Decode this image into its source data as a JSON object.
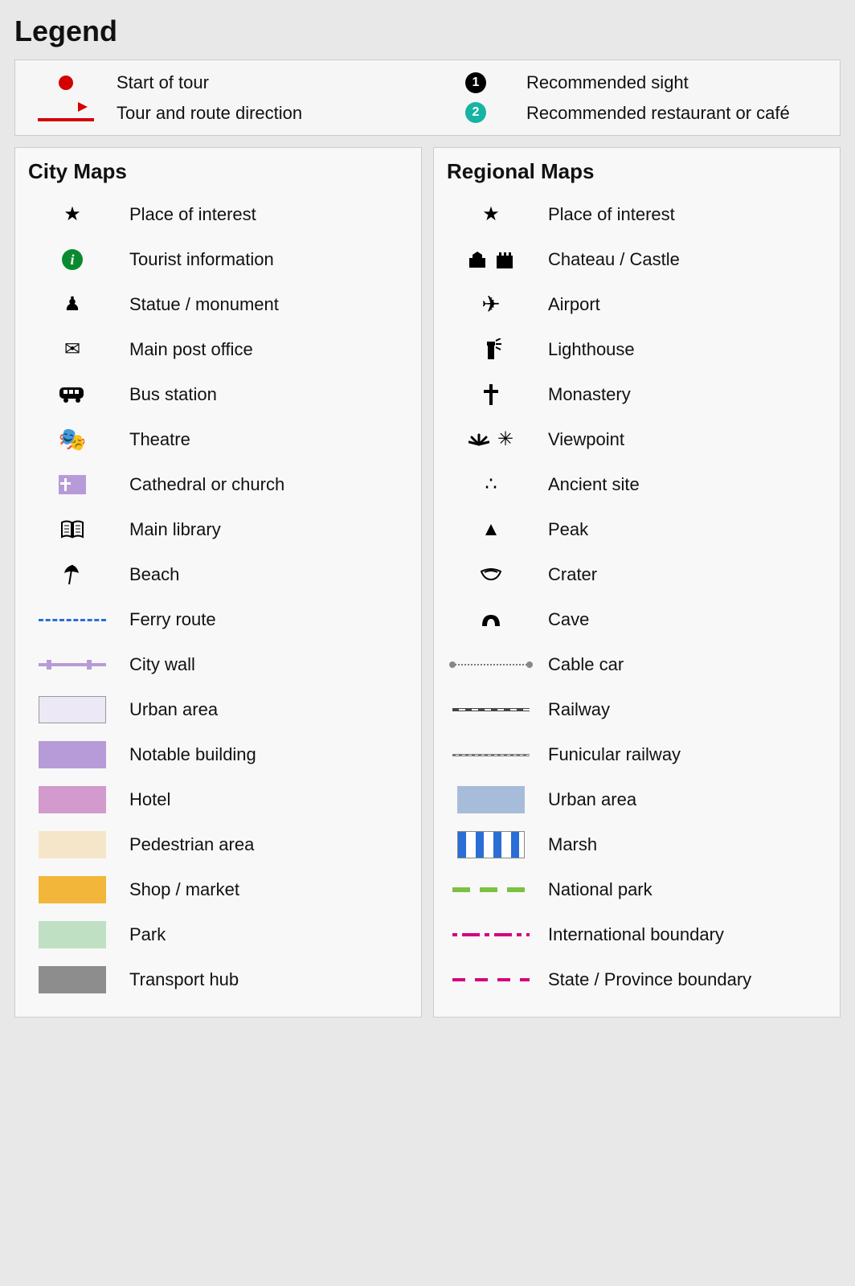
{
  "title": "Legend",
  "top": {
    "start": "Start of tour",
    "route": "Tour and route direction",
    "sight": "Recommended sight",
    "resto": "Recommended restaurant or café",
    "sight_num": "1",
    "resto_num": "2"
  },
  "city": {
    "title": "City Maps",
    "items": {
      "poi": "Place of interest",
      "tinfo": "Tourist information",
      "statue": "Statue / monument",
      "post": "Main post office",
      "bus": "Bus station",
      "theatre": "Theatre",
      "church": "Cathedral or church",
      "library": "Main library",
      "beach": "Beach",
      "ferry": "Ferry route",
      "wall": "City wall",
      "urban": "Urban area",
      "notable": "Notable building",
      "hotel": "Hotel",
      "ped": "Pedestrian area",
      "shop": "Shop / market",
      "park": "Park",
      "transport": "Transport hub"
    }
  },
  "regional": {
    "title": "Regional Maps",
    "items": {
      "poi": "Place of interest",
      "castle": "Chateau / Castle",
      "airport": "Airport",
      "lighthouse": "Lighthouse",
      "monastery": "Monastery",
      "viewpoint": "Viewpoint",
      "ancient": "Ancient site",
      "peak": "Peak",
      "crater": "Crater",
      "cave": "Cave",
      "cablecar": "Cable car",
      "railway": "Railway",
      "funicular": "Funicular railway",
      "urban": "Urban area",
      "marsh": "Marsh",
      "natpark": "National park",
      "intl": "International boundary",
      "state": "State / Province boundary"
    }
  },
  "colors": {
    "urban_light": "#ece8f5",
    "notable": "#b79bd8",
    "hotel": "#d39acd",
    "ped": "#f6e6c9",
    "shop": "#f2b63a",
    "park": "#bfe0c3",
    "transport": "#8d8d8d",
    "urban_regional": "#a7bcd9"
  }
}
